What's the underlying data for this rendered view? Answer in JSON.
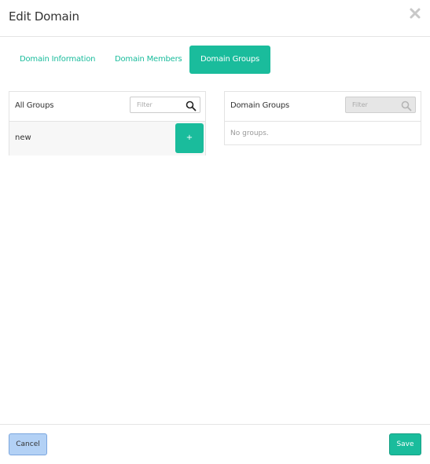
{
  "dialog": {
    "title": "Edit Domain"
  },
  "tabs": [
    {
      "label": "Domain Information",
      "active": false
    },
    {
      "label": "Domain Members",
      "active": false
    },
    {
      "label": "Domain Groups",
      "active": true
    }
  ],
  "all_groups": {
    "title": "All Groups",
    "filter_placeholder": "Filter",
    "items": [
      {
        "label": "new",
        "action": "+"
      }
    ]
  },
  "domain_groups": {
    "title": "Domain Groups",
    "filter_placeholder": "Filter",
    "empty_text": "No groups."
  },
  "footer": {
    "cancel_label": "Cancel",
    "save_label": "Save"
  },
  "colors": {
    "accent": "#1abc9c",
    "cancel_bg": "#b3d1f5"
  },
  "icons": {
    "close": "close-icon",
    "search": "search-icon"
  }
}
